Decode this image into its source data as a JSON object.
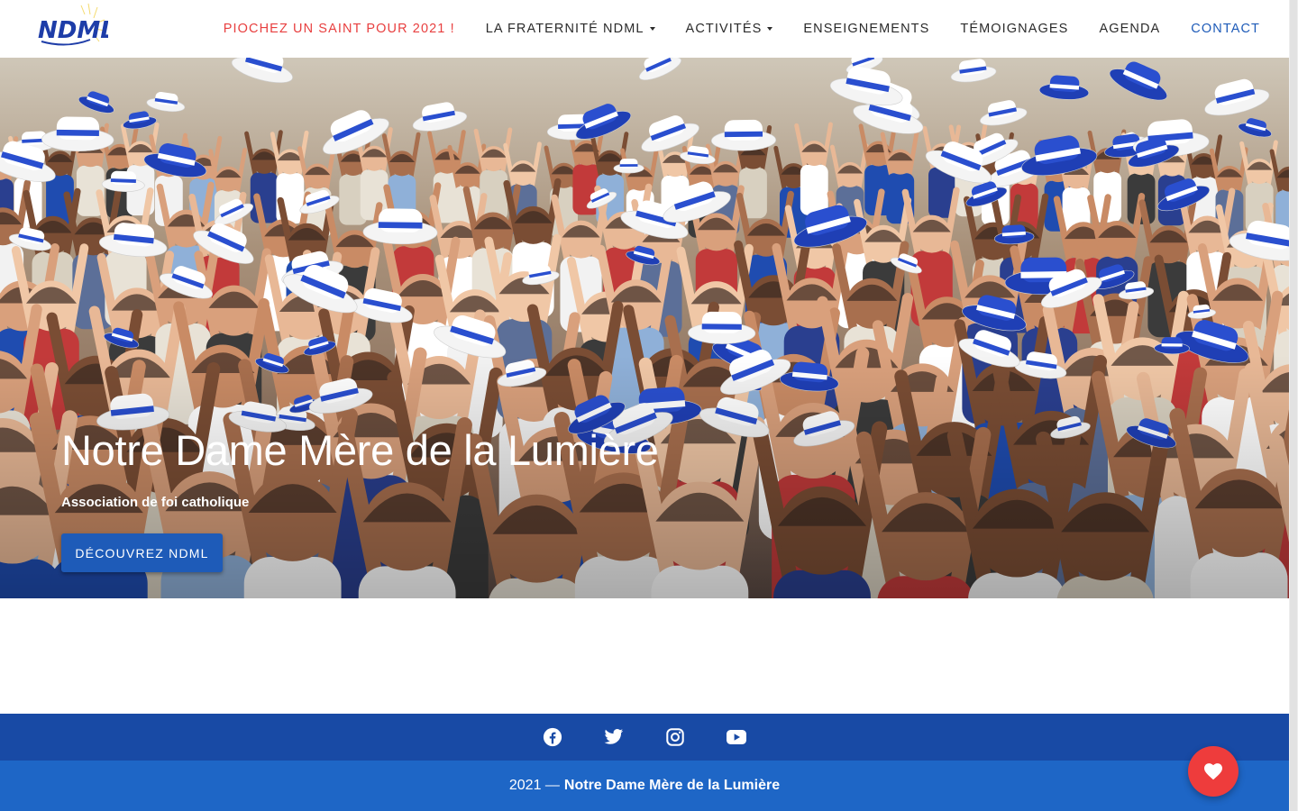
{
  "header": {
    "logo_text": "NDML",
    "nav": [
      {
        "label": "PIOCHEZ UN SAINT POUR 2021 !",
        "color": "#e83f3f"
      },
      {
        "label": "LA FRATERNITÉ NDML",
        "dropdown": true
      },
      {
        "label": "ACTIVITÉS",
        "dropdown": true
      },
      {
        "label": "ENSEIGNEMENTS"
      },
      {
        "label": "TÉMOIGNAGES"
      },
      {
        "label": "AGENDA"
      },
      {
        "label": "CONTACT",
        "color": "#1e5bb8"
      }
    ]
  },
  "hero": {
    "title": "Notre Dame Mère de la Lumière",
    "subtitle": "Association de foi catholique",
    "button_label": "DÉCOUVREZ NDML"
  },
  "social": {
    "icons": [
      "facebook-icon",
      "twitter-icon",
      "instagram-icon",
      "youtube-icon"
    ],
    "background": "#184aa5"
  },
  "footer": {
    "year": "2021 —",
    "org": "Notre Dame Mère de la Lumière",
    "background": "#1e66c6"
  },
  "fab": {
    "icon": "heart-icon",
    "color": "#ee3c3c"
  },
  "colors": {
    "accent": "#1e5bb8",
    "promo": "#e83f3f"
  }
}
